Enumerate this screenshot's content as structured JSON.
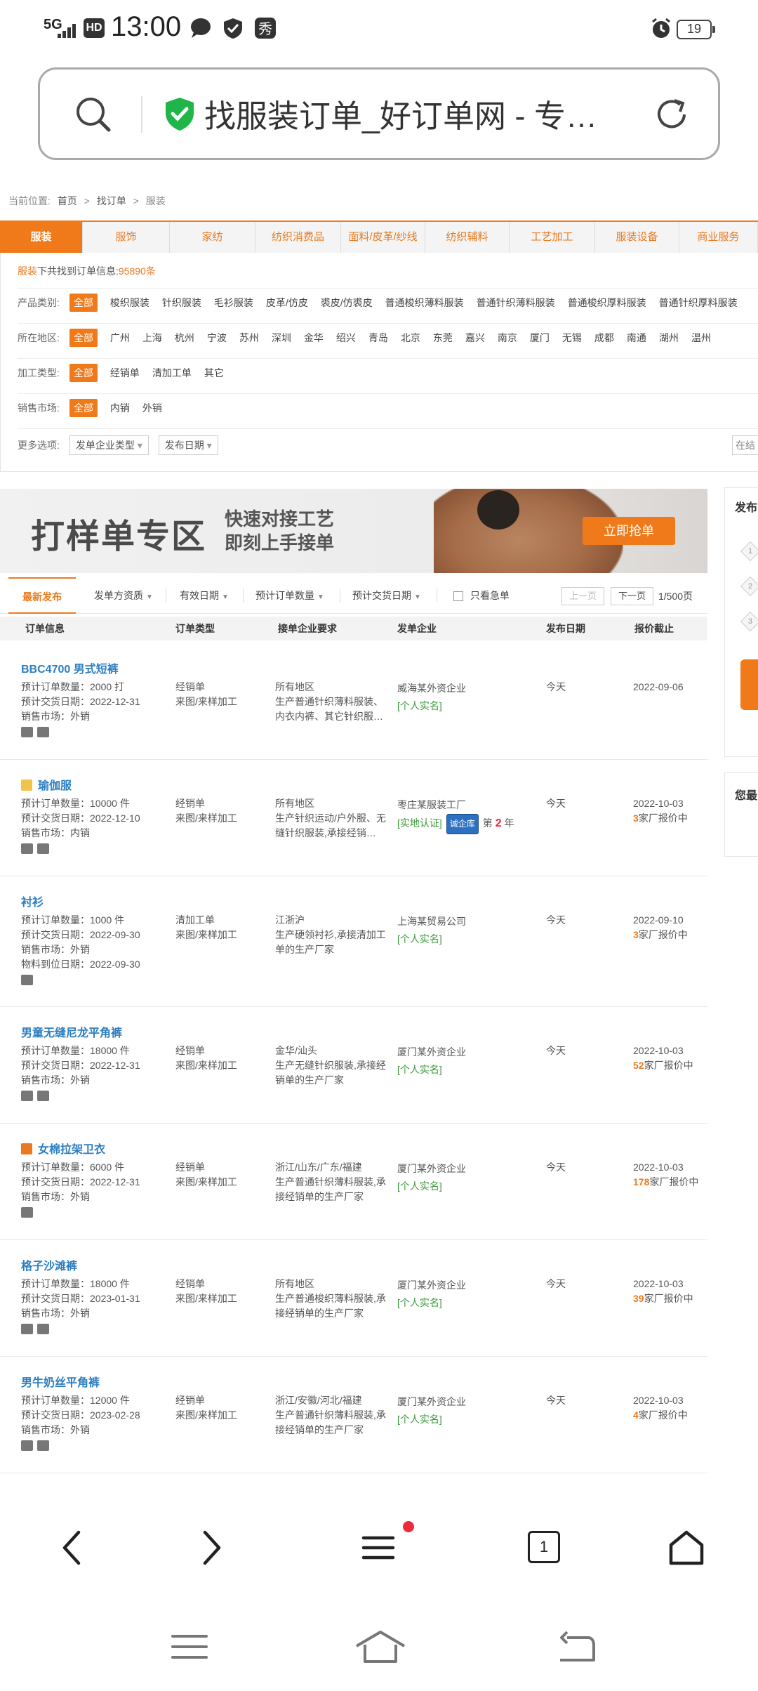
{
  "status": {
    "network": "5G",
    "hd": "HD",
    "time": "13:00",
    "battery": "19"
  },
  "urlbar": {
    "title": "找服装订单_好订单网 - 专…"
  },
  "breadcrumb": {
    "prefix": "当前位置:",
    "home": "首页",
    "sep": ">",
    "orders": "找订单",
    "current": "服装"
  },
  "category_tabs": [
    "服装",
    "服饰",
    "家纺",
    "纺织消费品",
    "面料/皮革/纱线",
    "纺织辅料",
    "工艺加工",
    "服装设备",
    "商业服务"
  ],
  "summary": {
    "prefix": "服装",
    "text": "下共找到订单信息:",
    "count": "95890条"
  },
  "filters": {
    "product_label": "产品类别:",
    "product_options": [
      "全部",
      "梭织服装",
      "针织服装",
      "毛衫服装",
      "皮革/仿皮",
      "裘皮/仿裘皮",
      "普通梭织薄料服装",
      "普通针织薄料服装",
      "普通梭织厚料服装",
      "普通针织厚料服装"
    ],
    "region_label": "所在地区:",
    "region_options": [
      "全部",
      "广州",
      "上海",
      "杭州",
      "宁波",
      "苏州",
      "深圳",
      "金华",
      "绍兴",
      "青岛",
      "北京",
      "东莞",
      "嘉兴",
      "南京",
      "厦门",
      "无锡",
      "成都",
      "南通",
      "湖州",
      "温州"
    ],
    "process_label": "加工类型:",
    "process_options": [
      "全部",
      "经销单",
      "清加工单",
      "其它"
    ],
    "market_label": "销售市场:",
    "market_options": [
      "全部",
      "内销",
      "外销"
    ],
    "more_label": "更多选项:",
    "more_select1": "发单企业类型",
    "more_select2": "发布日期",
    "more_right": "在结"
  },
  "banner": {
    "title": "打样单专区",
    "sub1": "快速对接工艺",
    "sub2": "即刻上手接单",
    "button": "立即抢单"
  },
  "right_panel": {
    "title": "发布",
    "steps": [
      "1",
      "2",
      "3"
    ],
    "title2": "您最"
  },
  "order_tabs": {
    "tabs": [
      "最新发布",
      "发单方资质",
      "有效日期",
      "预计订单数量",
      "预计交货日期"
    ],
    "urgent_only": "只看急单",
    "prev": "上一页",
    "next": "下一页",
    "pages": "1/500页"
  },
  "table_header": [
    "订单信息",
    "订单类型",
    "接单企业要求",
    "发单企业",
    "发布日期",
    "报价截止"
  ],
  "orders": [
    {
      "title": "BBC4700 男式短裤",
      "qty": "预计订单数量：2000 打",
      "delivery": "预计交货日期：2022-12-31",
      "market": "销售市场：外销",
      "extra": "",
      "type1": "经销单",
      "type2": "来图/来样加工",
      "req1": "所有地区",
      "req2": "生产普通针织薄料服装、",
      "req3": "内衣内裤、其它针织服…",
      "company": "威海某外资企业",
      "cert": "[个人实名]",
      "date": "今天",
      "deadline": "2022-09-06",
      "quote_num": "",
      "quote_text": ""
    },
    {
      "title": "瑜伽服",
      "qty": "预计订单数量：10000 件",
      "delivery": "预计交货日期：2022-12-10",
      "market": "销售市场：内销",
      "extra": "",
      "type1": "经销单",
      "type2": "来图/来样加工",
      "req1": "所有地区",
      "req2": "生产针织运动/户外服、无",
      "req3": "缝针织服装,承接经销…",
      "company": "枣庄某服装工厂",
      "cert": "[实地认证]",
      "badge": "诚企库",
      "year_prefix": "第",
      "year_num": "2",
      "year_suffix": "年",
      "date": "今天",
      "deadline": "2022-10-03",
      "quote_num": "3",
      "quote_text": "家厂报价中"
    },
    {
      "title": "衬衫",
      "qty": "预计订单数量：1000 件",
      "delivery": "预计交货日期：2022-09-30",
      "market": "销售市场：外销",
      "extra": "物料到位日期：2022-09-30",
      "type1": "清加工单",
      "type2": "来图/来样加工",
      "req1": "江浙沪",
      "req2": "生产硬领衬衫,承接清加工",
      "req3": "单的生产厂家",
      "company": "上海某贸易公司",
      "cert": "[个人实名]",
      "date": "今天",
      "deadline": "2022-09-10",
      "quote_num": "3",
      "quote_text": "家厂报价中"
    },
    {
      "title": "男童无缝尼龙平角裤",
      "qty": "预计订单数量：18000 件",
      "delivery": "预计交货日期：2022-12-31",
      "market": "销售市场：外销",
      "extra": "",
      "type1": "经销单",
      "type2": "来图/来样加工",
      "req1": "金华/汕头",
      "req2": "生产无缝针织服装,承接经",
      "req3": "销单的生产厂家",
      "company": "厦门某外资企业",
      "cert": "[个人实名]",
      "date": "今天",
      "deadline": "2022-10-03",
      "quote_num": "52",
      "quote_text": "家厂报价中"
    },
    {
      "title": "女棉拉架卫衣",
      "qty": "预计订单数量：6000 件",
      "delivery": "预计交货日期：2022-12-31",
      "market": "销售市场：外销",
      "extra": "",
      "type1": "经销单",
      "type2": "来图/来样加工",
      "req1": "浙江/山东/广东/福建",
      "req2": "生产普通针织薄料服装,承",
      "req3": "接经销单的生产厂家",
      "company": "厦门某外资企业",
      "cert": "[个人实名]",
      "date": "今天",
      "deadline": "2022-10-03",
      "quote_num": "178",
      "quote_text": "家厂报价中"
    },
    {
      "title": "格子沙滩裤",
      "qty": "预计订单数量：18000 件",
      "delivery": "预计交货日期：2023-01-31",
      "market": "销售市场：外销",
      "extra": "",
      "type1": "经销单",
      "type2": "来图/来样加工",
      "req1": "所有地区",
      "req2": "生产普通梭织薄料服装,承",
      "req3": "接经销单的生产厂家",
      "company": "厦门某外资企业",
      "cert": "[个人实名]",
      "date": "今天",
      "deadline": "2022-10-03",
      "quote_num": "39",
      "quote_text": "家厂报价中"
    },
    {
      "title": "男牛奶丝平角裤",
      "qty": "预计订单数量：12000 件",
      "delivery": "预计交货日期：2023-02-28",
      "market": "销售市场：外销",
      "extra": "",
      "type1": "经销单",
      "type2": "来图/来样加工",
      "req1": "浙江/安徽/河北/福建",
      "req2": "生产普通针织薄料服装,承",
      "req3": "接经销单的生产厂家",
      "company": "厦门某外资企业",
      "cert": "[个人实名]",
      "date": "今天",
      "deadline": "2022-10-03",
      "quote_num": "4",
      "quote_text": "家厂报价中"
    }
  ],
  "browser_nav": {
    "tab_count": "1"
  },
  "colors": {
    "accent": "#f07a1a",
    "link": "#2b7ec1",
    "cert_green": "#3a9a3a"
  }
}
